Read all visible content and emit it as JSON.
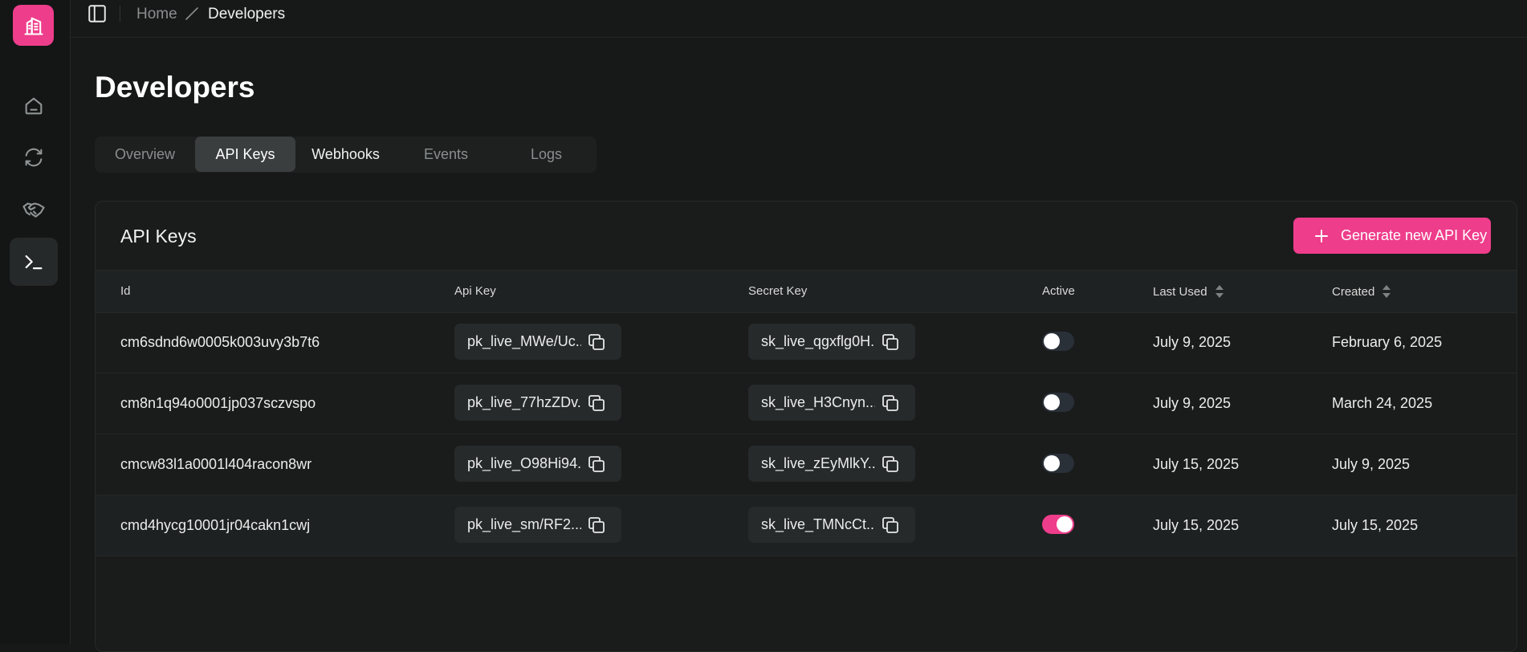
{
  "sidebar": {
    "logo_icon": "building-icon",
    "items": [
      {
        "name": "home",
        "icon": "home-icon"
      },
      {
        "name": "sync",
        "icon": "refresh-icon"
      },
      {
        "name": "partners",
        "icon": "handshake-icon"
      },
      {
        "name": "developers",
        "icon": "terminal-icon",
        "active": true
      }
    ]
  },
  "breadcrumb": {
    "home": "Home",
    "current": "Developers"
  },
  "page": {
    "title": "Developers"
  },
  "tabs": [
    {
      "label": "Overview"
    },
    {
      "label": "API Keys",
      "active": true
    },
    {
      "label": "Webhooks"
    },
    {
      "label": "Events"
    },
    {
      "label": "Logs"
    }
  ],
  "card": {
    "title": "API Keys",
    "generate_button": "Generate new API Key"
  },
  "table": {
    "columns": [
      "Id",
      "Api Key",
      "Secret Key",
      "Active",
      "Last Used",
      "Created"
    ],
    "rows": [
      {
        "id": "cm6sdnd6w0005k003uvy3b7t6",
        "api_key": "pk_live_MWe/Uc...",
        "secret_key": "sk_live_qgxflg0H...",
        "active": false,
        "last_used": "July 9, 2025",
        "created": "February 6, 2025"
      },
      {
        "id": "cm8n1q94o0001jp037sczvspo",
        "api_key": "pk_live_77hzZDv...",
        "secret_key": "sk_live_H3Cnyn...",
        "active": false,
        "last_used": "July 9, 2025",
        "created": "March 24, 2025"
      },
      {
        "id": "cmcw83l1a0001l404racon8wr",
        "api_key": "pk_live_O98Hi94...",
        "secret_key": "sk_live_zEyMlkY...",
        "active": false,
        "last_used": "July 15, 2025",
        "created": "July 9, 2025"
      },
      {
        "id": "cmd4hycg10001jr04cakn1cwj",
        "api_key": "pk_live_sm/RF2...",
        "secret_key": "sk_live_TMNcCt...",
        "active": true,
        "last_used": "July 15, 2025",
        "created": "July 15, 2025"
      }
    ]
  },
  "colors": {
    "accent": "#ee3d8b",
    "background": "#171818",
    "toggle_off": "#2a3038"
  }
}
